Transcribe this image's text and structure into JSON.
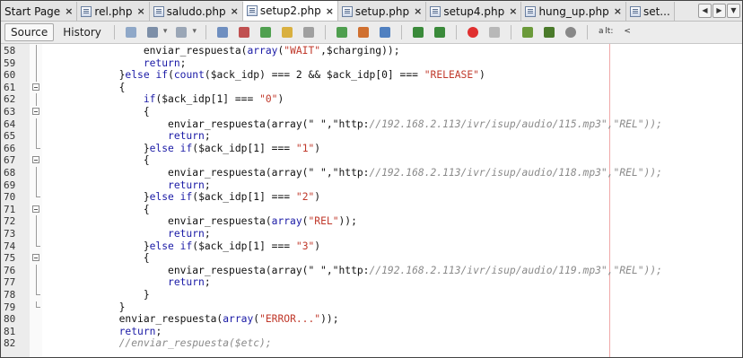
{
  "tabs": [
    {
      "label": "Start Page",
      "active": false,
      "icon": false
    },
    {
      "label": "rel.php",
      "active": false,
      "icon": true
    },
    {
      "label": "saludo.php",
      "active": false,
      "icon": true
    },
    {
      "label": "setup2.php",
      "active": true,
      "icon": true
    },
    {
      "label": "setup.php",
      "active": false,
      "icon": true
    },
    {
      "label": "setup4.php",
      "active": false,
      "icon": true
    },
    {
      "label": "hung_up.php",
      "active": false,
      "icon": true
    },
    {
      "label": "set...",
      "active": false,
      "icon": true,
      "noclose": true
    }
  ],
  "close_glyph": "×",
  "toolbar": {
    "source_label": "Source",
    "history_label": "History",
    "small_text": "a lt:",
    "lt": "<"
  },
  "lines": [
    {
      "n": "58",
      "code": "                enviar_respuesta(array(\"WAIT\",$charging));",
      "fold": "v"
    },
    {
      "n": "59",
      "code": "                return;",
      "fold": "v"
    },
    {
      "n": "60",
      "code": "            }else if(count($ack_idp) === 2 && $ack_idp[0] === \"RELEASE\")",
      "fold": "v"
    },
    {
      "n": "61",
      "code": "            {",
      "fold": "m"
    },
    {
      "n": "62",
      "code": "                if($ack_idp[1] === \"0\")",
      "fold": "v"
    },
    {
      "n": "63",
      "code": "                {",
      "fold": "m"
    },
    {
      "n": "64",
      "code": "                    enviar_respuesta(array(\" \",\"http://192.168.2.113/ivr/isup/audio/115.mp3\",\"REL\"));",
      "fold": "v"
    },
    {
      "n": "65",
      "code": "                    return;",
      "fold": "v"
    },
    {
      "n": "66",
      "code": "                }else if($ack_idp[1] === \"1\")",
      "fold": "e"
    },
    {
      "n": "67",
      "code": "                {",
      "fold": "m"
    },
    {
      "n": "68",
      "code": "                    enviar_respuesta(array(\" \",\"http://192.168.2.113/ivr/isup/audio/118.mp3\",\"REL\"));",
      "fold": "v"
    },
    {
      "n": "69",
      "code": "                    return;",
      "fold": "v"
    },
    {
      "n": "70",
      "code": "                }else if($ack_idp[1] === \"2\")",
      "fold": "e"
    },
    {
      "n": "71",
      "code": "                {",
      "fold": "m"
    },
    {
      "n": "72",
      "code": "                    enviar_respuesta(array(\"REL\"));",
      "fold": "v"
    },
    {
      "n": "73",
      "code": "                    return;",
      "fold": "v"
    },
    {
      "n": "74",
      "code": "                }else if($ack_idp[1] === \"3\")",
      "fold": "e"
    },
    {
      "n": "75",
      "code": "                {",
      "fold": "m"
    },
    {
      "n": "76",
      "code": "                    enviar_respuesta(array(\" \",\"http://192.168.2.113/ivr/isup/audio/119.mp3\",\"REL\"));",
      "fold": "v"
    },
    {
      "n": "77",
      "code": "                    return;",
      "fold": "v"
    },
    {
      "n": "78",
      "code": "                }",
      "fold": "e"
    },
    {
      "n": "79",
      "code": "            }",
      "fold": "e"
    },
    {
      "n": "80",
      "code": "            enviar_respuesta(array(\"ERROR...\"));",
      "fold": ""
    },
    {
      "n": "81",
      "code": "            return;",
      "fold": ""
    },
    {
      "n": "82",
      "code": "            //enviar_respuesta($etc);",
      "fold": ""
    }
  ],
  "colors": {
    "keyword": "#1a1aa6",
    "string": "#c0392b",
    "comment": "#8a8a8a",
    "margin_line": "#f0a8a8"
  }
}
